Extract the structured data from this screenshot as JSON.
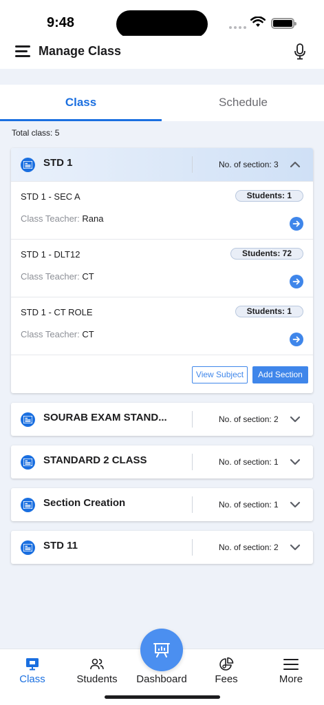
{
  "status_bar": {
    "time": "9:48"
  },
  "header": {
    "title": "Manage Class",
    "menu_icon": "hamburger-menu-icon",
    "mic_icon": "microphone-icon"
  },
  "tabs": [
    {
      "label": "Class",
      "active": true
    },
    {
      "label": "Schedule",
      "active": false
    }
  ],
  "summary": {
    "total_label": "Total class: 5"
  },
  "classes": [
    {
      "name": "STD 1",
      "sections_label": "No. of section: 3",
      "expanded": true,
      "sections": [
        {
          "name": "STD 1 - SEC A",
          "students_label": "Students: 1",
          "teacher_label": "Class Teacher:",
          "teacher": "Rana"
        },
        {
          "name": "STD 1 - DLT12",
          "students_label": "Students: 72",
          "teacher_label": "Class Teacher:",
          "teacher": "CT"
        },
        {
          "name": "STD 1 - CT ROLE",
          "students_label": "Students: 1",
          "teacher_label": "Class Teacher:",
          "teacher": "CT"
        }
      ],
      "actions": {
        "view_subject": "View Subject",
        "add_section": "Add Section"
      }
    },
    {
      "name": "SOURAB EXAM STAND...",
      "sections_label": "No. of section: 2",
      "expanded": false
    },
    {
      "name": "STANDARD 2 CLASS",
      "sections_label": "No. of section: 1",
      "expanded": false
    },
    {
      "name": "Section Creation",
      "sections_label": "No. of section: 1",
      "expanded": false
    },
    {
      "name": "STD 11",
      "sections_label": "No. of section: 2",
      "expanded": false
    }
  ],
  "bottom_nav": [
    {
      "label": "Class",
      "icon": "class-board-icon",
      "active": true
    },
    {
      "label": "Students",
      "icon": "students-icon",
      "active": false
    },
    {
      "label": "Dashboard",
      "icon": "dashboard-presentation-icon",
      "active": false
    },
    {
      "label": "Fees",
      "icon": "fees-pie-icon",
      "active": false
    },
    {
      "label": "More",
      "icon": "more-menu-icon",
      "active": false
    }
  ],
  "colors": {
    "accent": "#1a6fe0",
    "button": "#3f86ea",
    "background": "#eef2f9"
  }
}
